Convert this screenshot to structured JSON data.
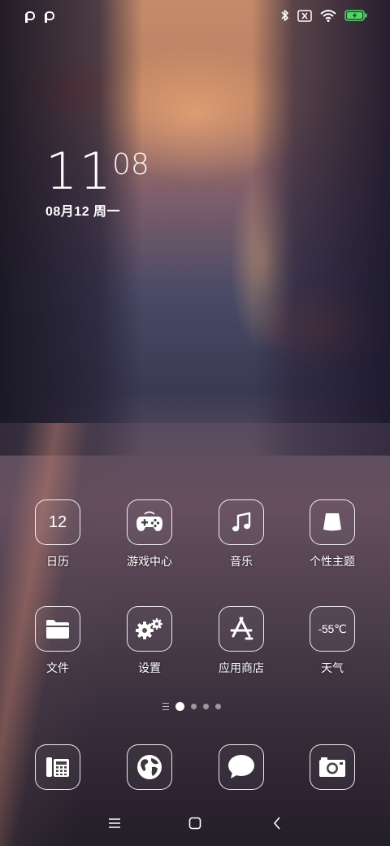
{
  "status_bar": {
    "left_icons": [
      "p-notification-icon",
      "p-notification-icon"
    ],
    "right_icons": [
      "bluetooth-icon",
      "no-sim-icon",
      "wifi-icon",
      "battery-charging-icon"
    ],
    "battery_color": "#4cd964"
  },
  "clock": {
    "hour": "11",
    "minute": "08",
    "date": "08月12 周一"
  },
  "apps": [
    {
      "label": "日历",
      "icon": "calendar-icon",
      "icon_text": "12"
    },
    {
      "label": "游戏中心",
      "icon": "gamepad-icon"
    },
    {
      "label": "音乐",
      "icon": "music-icon"
    },
    {
      "label": "个性主题",
      "icon": "theme-icon"
    },
    {
      "label": "文件",
      "icon": "folder-icon"
    },
    {
      "label": "设置",
      "icon": "gear-icon"
    },
    {
      "label": "应用商店",
      "icon": "app-store-icon"
    },
    {
      "label": "天气",
      "icon": "weather-icon",
      "icon_text": "-55℃"
    }
  ],
  "pager": {
    "pages": 4,
    "current_page": 1
  },
  "dock": [
    {
      "icon": "phone-icon"
    },
    {
      "icon": "browser-globe-icon"
    },
    {
      "icon": "messages-icon"
    },
    {
      "icon": "camera-icon"
    }
  ],
  "nav": {
    "buttons": [
      "menu-icon",
      "home-icon",
      "back-icon"
    ]
  }
}
